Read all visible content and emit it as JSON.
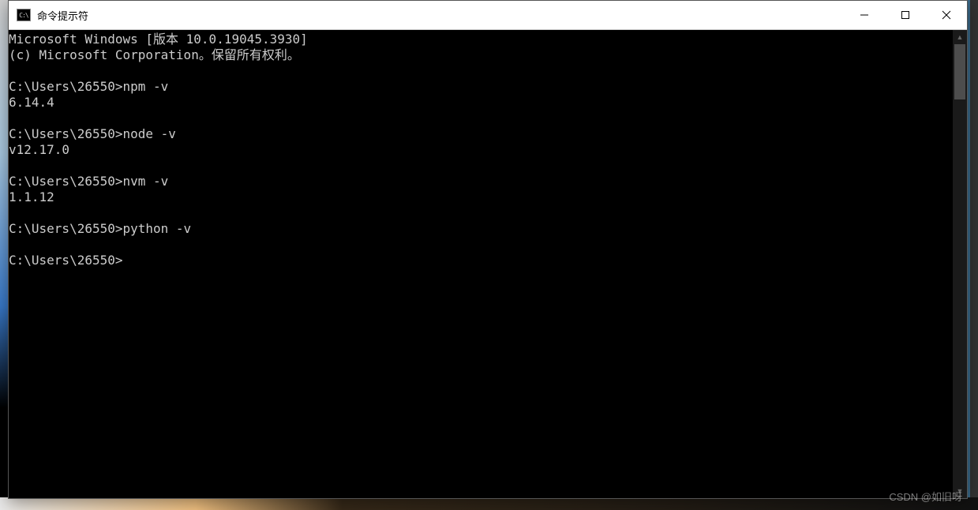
{
  "window": {
    "icon_text": "C:\\",
    "title": "命令提示符"
  },
  "terminal": {
    "lines": [
      "Microsoft Windows [版本 10.0.19045.3930]",
      "(c) Microsoft Corporation。保留所有权利。",
      "",
      "C:\\Users\\26550>npm -v",
      "6.14.4",
      "",
      "C:\\Users\\26550>node -v",
      "v12.17.0",
      "",
      "C:\\Users\\26550>nvm -v",
      "1.1.12",
      "",
      "C:\\Users\\26550>python -v",
      "",
      "C:\\Users\\26550>"
    ]
  },
  "watermark": "CSDN @如旧呀"
}
